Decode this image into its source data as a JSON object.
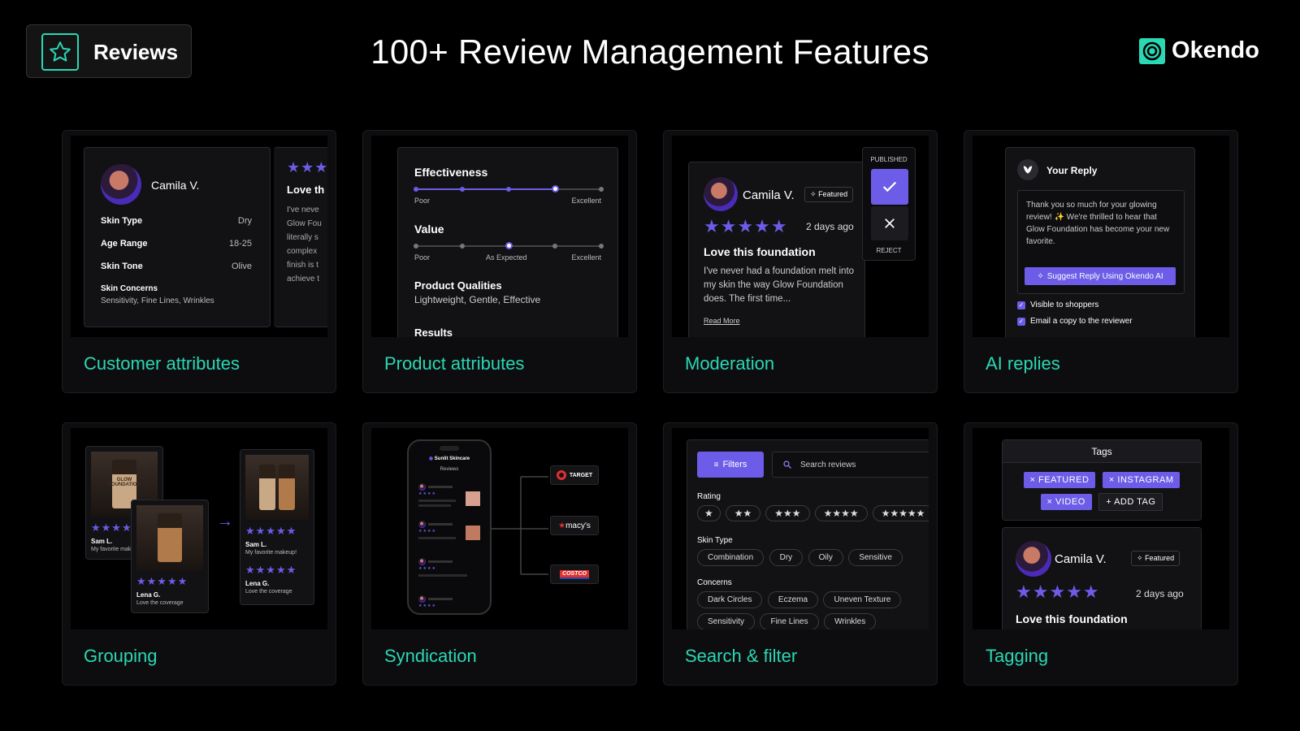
{
  "header": {
    "badge_label": "Reviews",
    "title": "100+ Review Management Features",
    "brand": "Okendo",
    "accent": "#2ad8b4",
    "purple": "#6c5ce7"
  },
  "cards": {
    "customer": {
      "label": "Customer attributes",
      "name": "Camila V.",
      "attrs": [
        {
          "k": "Skin Type",
          "v": "Dry"
        },
        {
          "k": "Age Range",
          "v": "18-25"
        },
        {
          "k": "Skin Tone",
          "v": "Olive"
        }
      ],
      "concerns_label": "Skin Concerns",
      "concerns_value": "Sensitivity, Fine Lines, Wrinkles",
      "peek_title": "Love th",
      "peek_lines": [
        "I've neve",
        "Glow Fou",
        "literally s",
        "complex",
        "finish is t",
        "achieve t"
      ]
    },
    "product": {
      "label": "Product attributes",
      "effectiveness": "Effectiveness",
      "eff_poor": "Poor",
      "eff_excellent": "Excellent",
      "eff_level": 0.75,
      "value": "Value",
      "val_poor": "Poor",
      "val_mid": "As Expected",
      "val_excellent": "Excellent",
      "val_level": 0.5,
      "qualities_label": "Product Qualities",
      "qualities_value": "Lightweight, Gentle, Effective",
      "results_label": "Results"
    },
    "moderation": {
      "label": "Moderation",
      "name": "Camila V.",
      "featured": "Featured",
      "rating": 5,
      "date": "2 days ago",
      "review_title": "Love this foundation",
      "review_body": "I've never had a foundation melt into my skin the way Glow Foundation does. The first time...",
      "read_more": "Read More",
      "published": "PUBLISHED",
      "reject": "REJECT"
    },
    "ai": {
      "label": "AI replies",
      "reply_title": "Your Reply",
      "reply_text": "Thank you so much for your glowing review! ✨ We're thrilled to hear that Glow Foundation has become your new favorite.",
      "suggest_button": "Suggest Reply Using Okendo AI",
      "visible": "Visible to shoppers",
      "email_copy": "Email a copy to the reviewer"
    },
    "grouping": {
      "label": "Grouping",
      "p1_name": "Sam L.",
      "p1_text": "My favorite makeup!",
      "p2_name": "Lena G.",
      "p2_text": "Love the coverage",
      "p3_name": "Sam L.",
      "p3_text": "My favorite makeup!",
      "p4_name": "Lena G.",
      "p4_text": "Love the coverage",
      "bottle_text": "GLOW FOUNDATION"
    },
    "syndication": {
      "label": "Syndication",
      "store": "Sunlit Skincare",
      "reviews": "Reviews",
      "retailers": [
        "TARGET",
        "macy's",
        "COSTCO"
      ]
    },
    "search": {
      "label": "Search & filter",
      "filters_button": "Filters",
      "search_placeholder": "Search reviews",
      "rating_label": "Rating",
      "skin_label": "Skin Type",
      "skin_types": [
        "Combination",
        "Dry",
        "Oily",
        "Sensitive"
      ],
      "concerns_label": "Concerns",
      "concerns": [
        "Dark Circles",
        "Eczema",
        "Uneven Texture",
        "Sensitivity",
        "Fine Lines",
        "Wrinkles"
      ]
    },
    "tagging": {
      "label": "Tagging",
      "tags_title": "Tags",
      "tags": [
        "FEATURED",
        "INSTAGRAM",
        "VIDEO"
      ],
      "add_tag": "+ ADD TAG",
      "name": "Camila V.",
      "featured": "Featured",
      "rating": 5,
      "date": "2 days ago",
      "review_title": "Love this foundation"
    }
  }
}
